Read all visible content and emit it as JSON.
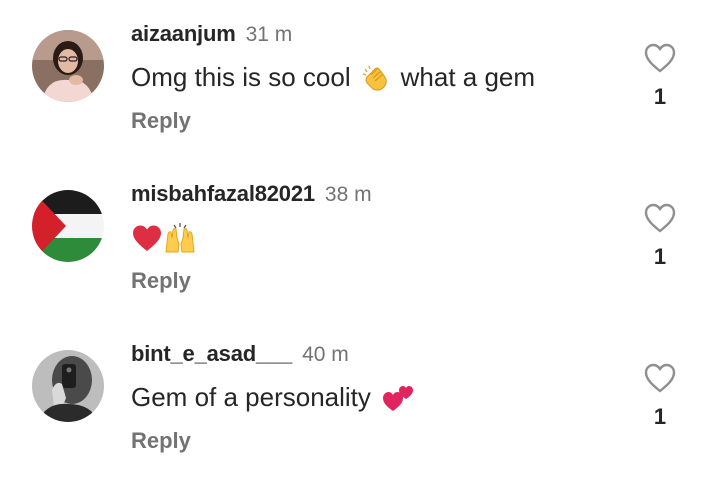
{
  "comments": [
    {
      "username": "aizaanjum",
      "time": "31 m",
      "text_before": "Omg this is so cool",
      "emoji": [
        "clapping-hands"
      ],
      "text_after": "what a gem",
      "reply_label": "Reply",
      "like_count": "1"
    },
    {
      "username": "misbahfazal82021",
      "time": "38 m",
      "text_before": "",
      "emoji": [
        "red-heart",
        "raising-hands"
      ],
      "text_after": "",
      "reply_label": "Reply",
      "like_count": "1"
    },
    {
      "username": "bint_e_asad___",
      "time": "40 m",
      "text_before": "Gem of a personality",
      "emoji": [
        "two-hearts"
      ],
      "text_after": "",
      "reply_label": "Reply",
      "like_count": "1"
    }
  ],
  "colors": {
    "text": "#262626",
    "secondary": "#737373",
    "background": "#ffffff"
  }
}
